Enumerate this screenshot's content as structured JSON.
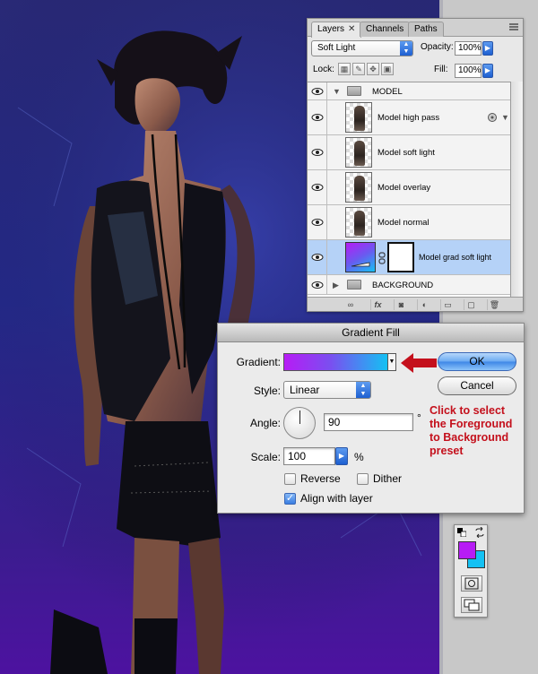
{
  "layers_panel": {
    "tabs": [
      {
        "label": "Layers",
        "close": "✕"
      },
      {
        "label": "Channels"
      },
      {
        "label": "Paths"
      }
    ],
    "blend_mode": "Soft Light",
    "opacity_label": "Opacity:",
    "opacity_value": "100%",
    "lock_label": "Lock:",
    "fill_label": "Fill:",
    "fill_value": "100%",
    "group_name": "MODEL",
    "layers": [
      {
        "name": "Model high pass"
      },
      {
        "name": "Model soft light"
      },
      {
        "name": "Model overlay"
      },
      {
        "name": "Model normal"
      },
      {
        "name": "Model grad soft light",
        "selected": true
      }
    ],
    "bottom_group": "BACKGROUND",
    "footer_fx": "fx"
  },
  "gradient_dialog": {
    "title": "Gradient Fill",
    "gradient_label": "Gradient:",
    "gradient_colors": [
      "#b71cf5",
      "#14c1f3"
    ],
    "ok_label": "OK",
    "cancel_label": "Cancel",
    "style_label": "Style:",
    "style_value": "Linear",
    "angle_label": "Angle:",
    "angle_value": "90",
    "angle_unit": "°",
    "scale_label": "Scale:",
    "scale_value": "100",
    "scale_unit": "%",
    "reverse_label": "Reverse",
    "reverse_checked": false,
    "dither_label": "Dither",
    "dither_checked": false,
    "align_label": "Align with layer",
    "align_checked": true,
    "callout_lines": [
      "Click to select",
      "the Foreground",
      "to Background",
      "preset"
    ]
  },
  "tools_palette": {
    "foreground_color": "#b71cf5",
    "background_color": "#14c1f3"
  }
}
